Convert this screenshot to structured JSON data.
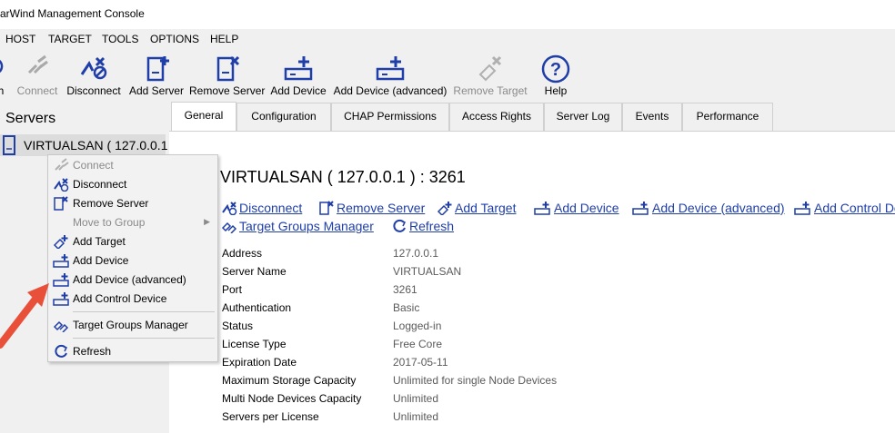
{
  "window": {
    "title": "arWind Management Console"
  },
  "menu": [
    "HOST",
    "TARGET",
    "TOOLS",
    "OPTIONS",
    "HELP"
  ],
  "toolbar": [
    {
      "label": "h",
      "icon": "refresh-icon",
      "enabled": true
    },
    {
      "label": "Connect",
      "icon": "connect-icon",
      "enabled": false
    },
    {
      "label": "Disconnect",
      "icon": "disconnect-icon",
      "enabled": true
    },
    {
      "label": "Add Server",
      "icon": "add-server-icon",
      "enabled": true
    },
    {
      "label": "Remove Server",
      "icon": "remove-server-icon",
      "enabled": true
    },
    {
      "label": "Add Device",
      "icon": "add-device-icon",
      "enabled": true
    },
    {
      "label": "Add Device (advanced)",
      "icon": "add-device-advanced-icon",
      "enabled": true
    },
    {
      "label": "Remove Target",
      "icon": "remove-target-icon",
      "enabled": false
    },
    {
      "label": "Help",
      "icon": "help-icon",
      "enabled": true
    }
  ],
  "tree": {
    "root": "Servers",
    "node": "VIRTUALSAN ( 127.0.0.1"
  },
  "tabs": [
    "General",
    "Configuration",
    "CHAP Permissions",
    "Access Rights",
    "Server Log",
    "Events",
    "Performance"
  ],
  "active_tab": "General",
  "server_title": "VIRTUALSAN ( 127.0.0.1 ) : 3261",
  "actions_row1": [
    "Disconnect",
    "Remove Server",
    "Add Target",
    "Add Device",
    "Add Device (advanced)",
    "Add Control De"
  ],
  "actions_row2": [
    "Target Groups Manager",
    "Refresh"
  ],
  "properties": [
    {
      "key": "Address",
      "value": "127.0.0.1"
    },
    {
      "key": "Server Name",
      "value": "VIRTUALSAN"
    },
    {
      "key": "Port",
      "value": "3261"
    },
    {
      "key": "Authentication",
      "value": "Basic"
    },
    {
      "key": "Status",
      "value": "Logged-in"
    },
    {
      "key": "License Type",
      "value": "Free Core"
    },
    {
      "key": "Expiration Date",
      "value": "2017-05-11"
    },
    {
      "key": "Maximum Storage Capacity",
      "value": "Unlimited for single Node Devices"
    },
    {
      "key": "Multi Node Devices Capacity",
      "value": "Unlimited"
    },
    {
      "key": "Servers per License",
      "value": "Unlimited"
    }
  ],
  "context_menu": [
    {
      "label": "Connect",
      "icon": "connect-icon",
      "enabled": false
    },
    {
      "label": "Disconnect",
      "icon": "disconnect-icon",
      "enabled": true
    },
    {
      "label": "Remove Server",
      "icon": "remove-server-icon",
      "enabled": true
    },
    {
      "label": "Move to Group",
      "icon": "",
      "enabled": false,
      "submenu": true
    },
    {
      "label": "Add Target",
      "icon": "add-target-icon",
      "enabled": true
    },
    {
      "label": "Add Device",
      "icon": "add-device-icon",
      "enabled": true
    },
    {
      "label": "Add Device (advanced)",
      "icon": "add-device-advanced-icon",
      "enabled": true
    },
    {
      "label": "Add Control Device",
      "icon": "add-control-device-icon",
      "enabled": true
    },
    {
      "label": "Target Groups Manager",
      "icon": "target-groups-icon",
      "enabled": true
    },
    {
      "label": "Refresh",
      "icon": "refresh-icon",
      "enabled": true
    }
  ],
  "colors": {
    "link": "#1f3ea8",
    "icon": "#1f3ea8",
    "arrow": "#e8503a",
    "disabled": "#8a8a8a"
  }
}
